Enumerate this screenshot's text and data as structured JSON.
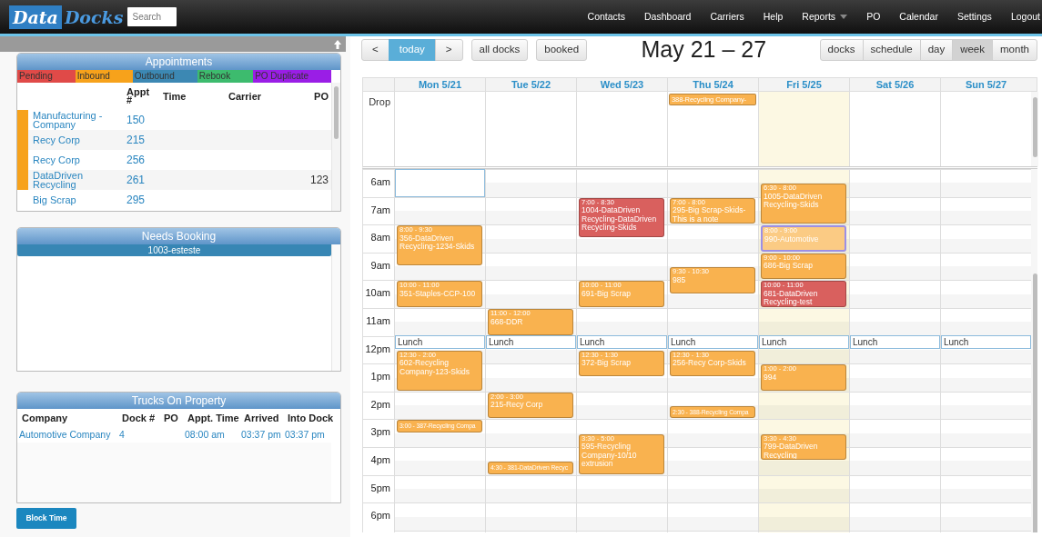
{
  "navbar": {
    "logo": {
      "word_1": "Data",
      "word_2": "Docks"
    },
    "search": {
      "placeholder": "Search"
    },
    "links": [
      {
        "label": "Contacts",
        "dropdown": false
      },
      {
        "label": "Dashboard",
        "dropdown": false
      },
      {
        "label": "Carriers",
        "dropdown": false
      },
      {
        "label": "Help",
        "dropdown": false
      },
      {
        "label": "Reports",
        "dropdown": true
      },
      {
        "label": "PO",
        "dropdown": false
      },
      {
        "label": "Calendar",
        "dropdown": false
      },
      {
        "label": "Settings",
        "dropdown": false
      },
      {
        "label": "Logout",
        "dropdown": false
      }
    ]
  },
  "appointments": {
    "title": "Appointments",
    "legend": [
      {
        "label": "Pending",
        "color": "#e04a48"
      },
      {
        "label": "Inbound",
        "color": "#f7a21b"
      },
      {
        "label": "Outbound",
        "color": "#3c88b3"
      },
      {
        "label": "Rebook",
        "color": "#3dbb6e"
      },
      {
        "label": "PO Duplicate",
        "color": "#9a1ee6"
      }
    ],
    "columns": [
      "Appt #",
      "Time",
      "Carrier",
      "PO"
    ],
    "rows": [
      {
        "company": "Manufacturing - Company",
        "appt": "150",
        "color": "#f7a21b"
      },
      {
        "company": "Recy Corp",
        "appt": "215",
        "color": "#f7a21b"
      },
      {
        "company": "Recy Corp",
        "appt": "256",
        "color": "#f7a21b"
      },
      {
        "company": "DataDriven Recycling",
        "appt": "261",
        "po": "123",
        "color": "#f7a21b"
      },
      {
        "company": "Big Scrap",
        "appt": "295"
      }
    ]
  },
  "needs_booking": {
    "title": "Needs Booking",
    "items": [
      {
        "label": "1003-esteste"
      }
    ]
  },
  "trucks": {
    "title": "Trucks On Property",
    "columns": [
      "Company",
      "Dock #",
      "PO",
      "Appt. Time",
      "Arrived",
      "Into Dock"
    ],
    "rows": [
      {
        "company": "Automotive Company",
        "dock": "4",
        "appt_time": "08:00 am",
        "arrived": "03:37 pm",
        "into_dock": "03:37 pm"
      }
    ]
  },
  "block_time_button": "Block Time",
  "calendar": {
    "nav": [
      {
        "label": "<",
        "selected": false
      },
      {
        "label": "today",
        "selected": true
      },
      {
        "label": ">",
        "selected": false
      }
    ],
    "filters": [
      {
        "label": "all docks"
      },
      {
        "label": "booked"
      }
    ],
    "title": "May 21 – 27",
    "views": [
      {
        "label": "docks",
        "selected": false
      },
      {
        "label": "schedule",
        "selected": false
      },
      {
        "label": "day",
        "selected": false
      },
      {
        "label": "week",
        "selected": true
      },
      {
        "label": "month",
        "selected": false
      }
    ],
    "drop_label": "Drop",
    "hours": [
      {
        "label": "6am",
        "highlighted": true
      },
      {
        "label": "7am"
      },
      {
        "label": "8am"
      },
      {
        "label": "9am"
      },
      {
        "label": "10am"
      },
      {
        "label": "11am"
      },
      {
        "label": "12pm",
        "blocks": [
          "Lunch",
          "Lunch",
          "Lunch",
          "Lunch",
          "Lunch",
          "Lunch",
          "Lunch"
        ]
      },
      {
        "label": "1pm"
      },
      {
        "label": "2pm"
      },
      {
        "label": "3pm"
      },
      {
        "label": "4pm"
      },
      {
        "label": "5pm"
      },
      {
        "label": "6pm"
      }
    ],
    "days": [
      {
        "label": "Mon 5/21",
        "today": false,
        "events": [
          {
            "kind": "timed",
            "time": "8:00 - 9:30",
            "title": "356-DataDriven Recycling-1234-Skids",
            "color": "#f9b24f",
            "selected": false
          },
          {
            "kind": "timed",
            "time": "10:00 - 11:00",
            "title": "351-Staples-CCP-100",
            "color": "#f9b24f",
            "selected": false
          },
          {
            "kind": "timed",
            "time": "12:30 - 2:00",
            "title": "602-Recycling Company-123-Skids",
            "color": "#f9b24f",
            "selected": false
          },
          {
            "kind": "short",
            "text": "3:00 - 387-Recycling Compa",
            "color": "#f9b24f",
            "selected": false
          }
        ]
      },
      {
        "label": "Tue 5/22",
        "today": false,
        "events": [
          {
            "kind": "timed",
            "time": "11:00 - 12:00",
            "title": "668-DDR",
            "color": "#f9b24f",
            "selected": false
          },
          {
            "kind": "timed",
            "time": "2:00 - 3:00",
            "title": "215-Recy Corp",
            "color": "#f9b24f",
            "selected": false
          },
          {
            "kind": "short",
            "text": "4:30 - 381-DataDriven Recyc",
            "color": "#f9b24f",
            "selected": false
          }
        ]
      },
      {
        "label": "Wed 5/23",
        "today": false,
        "events": [
          {
            "kind": "timed",
            "time": "7:00 - 8:30",
            "title": "1004-DataDriven Recycling-DataDriven Recycling-Skids",
            "color": "#d9605e",
            "selected": false
          },
          {
            "kind": "timed",
            "time": "10:00 - 11:00",
            "title": "691-Big Scrap",
            "color": "#f9b24f",
            "selected": false
          },
          {
            "kind": "timed",
            "time": "12:30 - 1:30",
            "title": "372-Big Scrap",
            "color": "#f9b24f",
            "selected": false
          },
          {
            "kind": "timed",
            "time": "3:30 - 5:00",
            "title": "595-Recycling Company-10/10 extrusion",
            "color": "#f9b24f",
            "selected": false
          }
        ]
      },
      {
        "label": "Thu 5/24",
        "today": false,
        "drop": [
          {
            "title": "388-Recycling Company-",
            "color": "#f9b24f"
          }
        ],
        "events": [
          {
            "kind": "timed",
            "time": "7:00 - 8:00",
            "title": "295-Big Scrap-Skids-This is a note",
            "color": "#f9b24f",
            "selected": false
          },
          {
            "kind": "timed",
            "time": "9:30 - 10:30",
            "title": "985",
            "color": "#f9b24f",
            "selected": false
          },
          {
            "kind": "timed",
            "time": "12:30 - 1:30",
            "title": "256-Recy Corp-Skids",
            "color": "#f9b24f",
            "selected": false
          },
          {
            "kind": "short",
            "text": "2:30 - 388-Recycling Compa",
            "color": "#f9b24f",
            "selected": false
          }
        ]
      },
      {
        "label": "Fri 5/25",
        "today": true,
        "events": [
          {
            "kind": "timed",
            "time": "6:30 - 8:00",
            "title": "1005-DataDriven Recycling-Skids",
            "color": "#f9b24f",
            "selected": false
          },
          {
            "kind": "timed",
            "time": "8:00 - 9:00",
            "title": "990-Automotive",
            "color": "#fbcb84",
            "selected": true
          },
          {
            "kind": "timed",
            "time": "9:00 - 10:00",
            "title": "686-Big Scrap",
            "color": "#f9b24f",
            "selected": false
          },
          {
            "kind": "timed",
            "time": "10:00 - 11:00",
            "title": "681-DataDriven Recycling-test",
            "color": "#d9605e",
            "selected": false
          },
          {
            "kind": "timed",
            "time": "1:00 - 2:00",
            "title": "994",
            "color": "#f9b24f",
            "selected": false
          },
          {
            "kind": "timed",
            "time": "3:30 - 4:30",
            "title": "799-DataDriven Recycling",
            "color": "#f9b24f",
            "selected": false
          }
        ]
      },
      {
        "label": "Sat 5/26",
        "today": false
      },
      {
        "label": "Sun 5/27",
        "today": false
      }
    ]
  }
}
